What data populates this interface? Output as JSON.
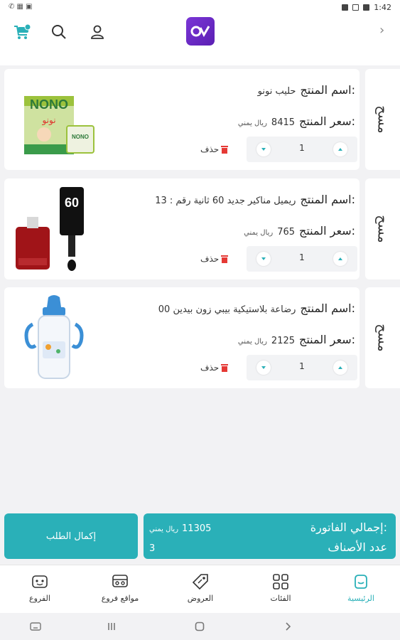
{
  "status_bar": {
    "left_icons": "✆ ▦ ▣",
    "time": "1:42"
  },
  "header": {
    "back_icon": "chevron-right-icon"
  },
  "cart": {
    "side_tab_label": "مسح",
    "name_label": "اسم المنتج:",
    "price_label": "سعر المنتج:",
    "currency": "ريال يمني",
    "delete_label": "حذف",
    "items": [
      {
        "name": "حليب نونو",
        "price": "8415",
        "quantity": "1",
        "image": "nono-milk-can"
      },
      {
        "name": "ريميل مناكير جديد 60 ثانية رقم : 13",
        "price": "765",
        "quantity": "1",
        "image": "rimmel-nail-polish"
      },
      {
        "name": "رضاعة بلاستيكية بيبي زون بيدين 00",
        "price": "2125",
        "quantity": "1",
        "image": "baby-bottle"
      }
    ]
  },
  "summary": {
    "total_label": "إجمالي الفاتورة:",
    "total_value": "11305",
    "total_currency": "ريال يمني",
    "count_label": "عدد الأصناف",
    "count_value": "3",
    "checkout_label": "إكمال الطلب"
  },
  "bottom_nav": [
    {
      "label": "الرئيسية",
      "icon": "home-icon",
      "active": true
    },
    {
      "label": "الفئات",
      "icon": "categories-icon",
      "active": false
    },
    {
      "label": "العروض",
      "icon": "offers-tag-icon",
      "active": false
    },
    {
      "label": "مواقع فروع",
      "icon": "branch-locations-icon",
      "active": false
    },
    {
      "label": "الفروع",
      "icon": "branches-icon",
      "active": false
    }
  ],
  "colors": {
    "accent": "#2ab0b8",
    "brand": "#6a2bc7",
    "delete": "#e53935"
  }
}
